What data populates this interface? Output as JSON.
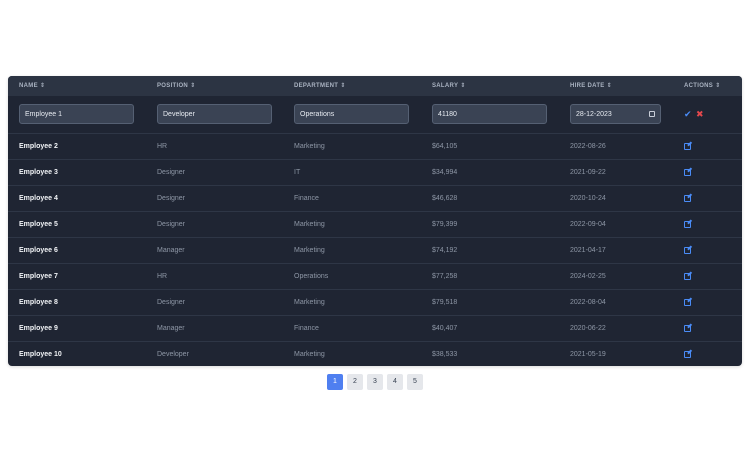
{
  "table": {
    "headers": [
      {
        "label": "NAME",
        "sort_icon": "⇕"
      },
      {
        "label": "POSITION",
        "sort_icon": "⇕"
      },
      {
        "label": "DEPARTMENT",
        "sort_icon": "⇕"
      },
      {
        "label": "SALARY",
        "sort_icon": "⇕"
      },
      {
        "label": "HIRE DATE",
        "sort_icon": "⇕"
      },
      {
        "label": "ACTIONS",
        "sort_icon": "⇕"
      }
    ],
    "edit_row": {
      "name": "Employee 1",
      "position": "Developer",
      "department": "Operations",
      "salary": "41180",
      "hire_date": "28-12-2023",
      "save_icon": "check-icon",
      "cancel_icon": "x-icon"
    },
    "rows": [
      {
        "name": "Employee 2",
        "position": "HR",
        "department": "Marketing",
        "salary": "$64,105",
        "hire_date": "2022-08-26"
      },
      {
        "name": "Employee 3",
        "position": "Designer",
        "department": "IT",
        "salary": "$34,994",
        "hire_date": "2021-09-22"
      },
      {
        "name": "Employee 4",
        "position": "Designer",
        "department": "Finance",
        "salary": "$46,628",
        "hire_date": "2020-10-24"
      },
      {
        "name": "Employee 5",
        "position": "Designer",
        "department": "Marketing",
        "salary": "$79,399",
        "hire_date": "2022-09-04"
      },
      {
        "name": "Employee 6",
        "position": "Manager",
        "department": "Marketing",
        "salary": "$74,192",
        "hire_date": "2021-04-17"
      },
      {
        "name": "Employee 7",
        "position": "HR",
        "department": "Operations",
        "salary": "$77,258",
        "hire_date": "2024-02-25"
      },
      {
        "name": "Employee 8",
        "position": "Designer",
        "department": "Marketing",
        "salary": "$79,518",
        "hire_date": "2022-08-04"
      },
      {
        "name": "Employee 9",
        "position": "Manager",
        "department": "Finance",
        "salary": "$40,407",
        "hire_date": "2020-06-22"
      },
      {
        "name": "Employee 10",
        "position": "Developer",
        "department": "Marketing",
        "salary": "$38,533",
        "hire_date": "2021-05-19"
      }
    ]
  },
  "pagination": {
    "pages": [
      "1",
      "2",
      "3",
      "4",
      "5"
    ],
    "active": "1"
  },
  "colors": {
    "table_bg": "#1f2533",
    "header_bg": "#2c3443",
    "accent": "#4f7ff0",
    "edit_icon": "#4a8cf7",
    "cancel": "#e5484d"
  }
}
